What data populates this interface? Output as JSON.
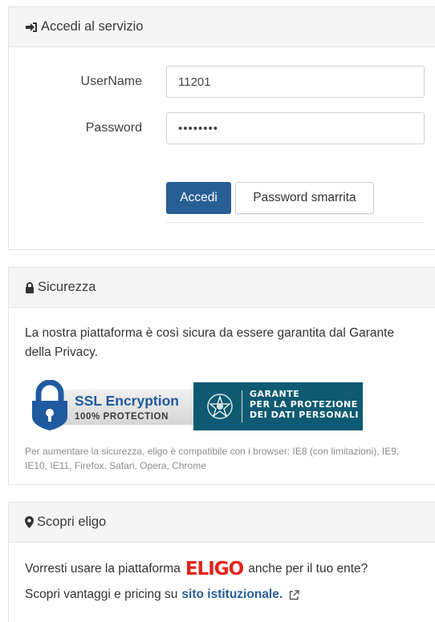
{
  "login": {
    "title": "Accedi al servizio",
    "username_label": "UserName",
    "username_value": "11201",
    "password_label": "Password",
    "password_value": "••••••••",
    "submit_label": "Accedi",
    "forgot_label": "Password smarrita",
    "icon": "sign-in-icon"
  },
  "security": {
    "title": "Sicurezza",
    "icon": "lock-icon",
    "text": "La nostra piattaforma è così sicura da essere garantita dal Garante della Privacy.",
    "ssl_title": "SSL Encryption",
    "ssl_sub": "100% PROTECTION",
    "garante_lines": [
      "GARANTE",
      "PER LA PROTEZIONE",
      "DEI DATI PERSONALI"
    ],
    "note": "Per aumentare la sicurezza, eligo è compatibile con i browser: IE8 (con limitazioni), IE9, IE10, IE11, Firefox, Safari, Opera, Chrome"
  },
  "eligo": {
    "title": "Scopri eligo",
    "icon": "map-marker-icon",
    "line1_before": "Vorresti usare la piattaforma",
    "logo": "ELIGO",
    "line1_after": "anche per il tuo ente?",
    "line2_before": "Scopri vantaggi e pricing su",
    "link_label": "sito istituzionale.",
    "link_icon": "external-link-icon"
  },
  "colors": {
    "primary": "#275f95",
    "panel_header": "#f5f5f5",
    "garante_bg": "#0e5a72",
    "eligo_red": "#e2231a"
  }
}
